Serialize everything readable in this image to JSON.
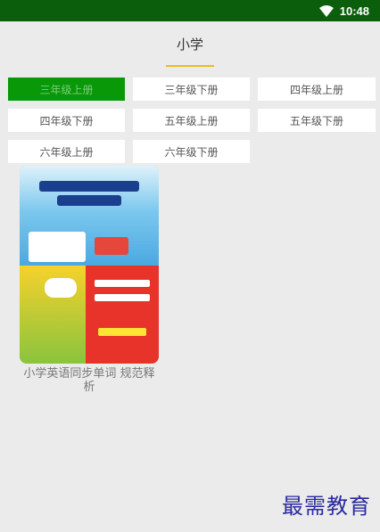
{
  "status_bar": {
    "time": "10:48",
    "icon": "wifi-icon"
  },
  "tabs": [
    {
      "label": "小学",
      "selected": true
    }
  ],
  "grades": [
    {
      "label": "三年级上册",
      "selected": true
    },
    {
      "label": "三年级下册",
      "selected": false
    },
    {
      "label": "四年级上册",
      "selected": false
    },
    {
      "label": "四年级下册",
      "selected": false
    },
    {
      "label": "五年级上册",
      "selected": false
    },
    {
      "label": "五年级下册",
      "selected": false
    },
    {
      "label": "六年级上册",
      "selected": false
    },
    {
      "label": "六年级下册",
      "selected": false
    }
  ],
  "books": [
    {
      "title": "小学英语同步单词 规范释析"
    }
  ],
  "watermark": "最需教育",
  "colors": {
    "status_bar": "#0b5e0b",
    "selected_grade": "#089808",
    "tab_indicator": "#f0b71e"
  }
}
